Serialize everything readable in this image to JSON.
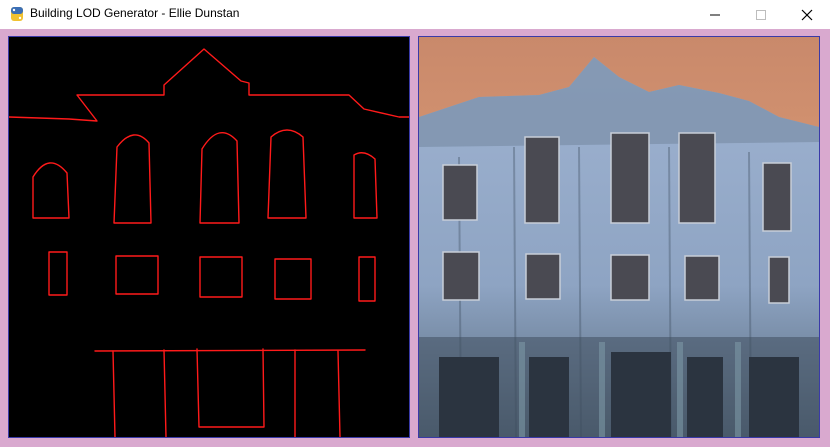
{
  "window": {
    "title": "Building LOD Generator - Ellie Dunstan",
    "app_icon": "python-icon",
    "controls": {
      "minimize": "minimize-icon",
      "maximize": "maximize-icon",
      "close": "close-icon"
    }
  },
  "canvas": {
    "stroke_color": "#ff1a1a",
    "background": "#000000"
  },
  "output": {
    "description_icon": "generated-building-image"
  },
  "colors": {
    "frame_background": "#d9a9cf",
    "titlebar": "#ffffff",
    "panel_border": "#3a3aa8"
  }
}
